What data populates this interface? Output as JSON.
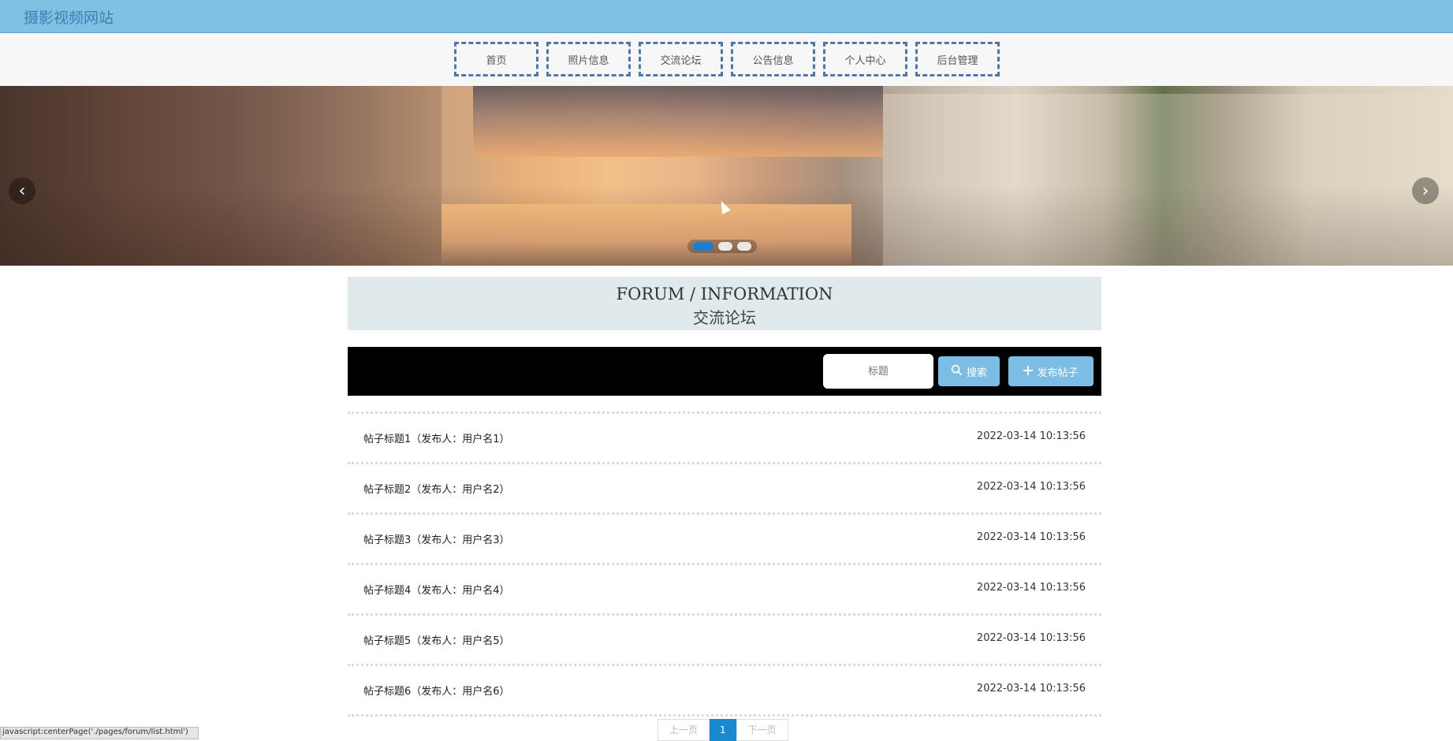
{
  "header": {
    "site_title": "摄影视频网站"
  },
  "nav": {
    "items": [
      "首页",
      "照片信息",
      "交流论坛",
      "公告信息",
      "个人中心",
      "后台管理"
    ]
  },
  "banner": {
    "prev_icon": "chevron-left-icon",
    "next_icon": "chevron-right-icon",
    "prev_glyph": "‹",
    "next_glyph": "›",
    "slide_count": 3,
    "active_slide": 1
  },
  "section": {
    "title_en": "FORUM / INFORMATION",
    "title_cn": "交流论坛"
  },
  "search": {
    "placeholder": "标题",
    "search_label": "搜索",
    "search_icon": "search-icon",
    "post_label": "发布帖子",
    "post_icon": "plus-icon"
  },
  "posts": [
    {
      "title": "帖子标题1（发布人：用户名1）",
      "time": "2022-03-14 10:13:56"
    },
    {
      "title": "帖子标题2（发布人：用户名2）",
      "time": "2022-03-14 10:13:56"
    },
    {
      "title": "帖子标题3（发布人：用户名3）",
      "time": "2022-03-14 10:13:56"
    },
    {
      "title": "帖子标题4（发布人：用户名4）",
      "time": "2022-03-14 10:13:56"
    },
    {
      "title": "帖子标题5（发布人：用户名5）",
      "time": "2022-03-14 10:13:56"
    },
    {
      "title": "帖子标题6（发布人：用户名6）",
      "time": "2022-03-14 10:13:56"
    }
  ],
  "pager": {
    "prev": "上一页",
    "current": "1",
    "next": "下一页"
  },
  "status_bar": {
    "text": "javascript:centerPage('./pages/forum/list.html')"
  },
  "colors": {
    "topbar": "#80c0e4",
    "accent": "#1a8ad0",
    "button": "#7cbde6",
    "nav_border": "#4a78b0"
  }
}
